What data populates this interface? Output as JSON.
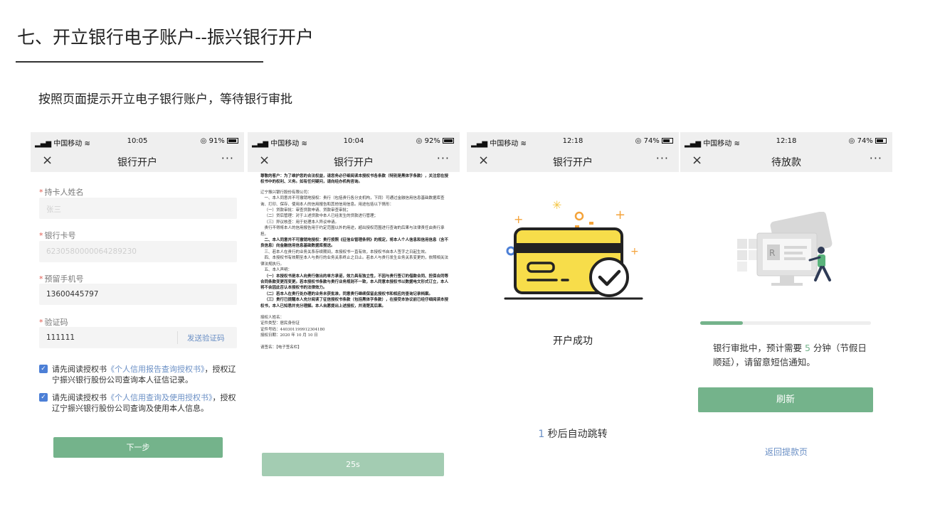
{
  "slide": {
    "title": "七、开立银行电子账户--振兴银行开户",
    "subtitle": "按照页面提示开立电子银行账户，等待银行审批"
  },
  "colors": {
    "accent_green": "#74b38b",
    "link_blue": "#6a8fc5",
    "required_red": "#e05a4f",
    "card_yellow": "#f7dd4a"
  },
  "phone1": {
    "status": {
      "carrier": "中国移动",
      "time": "10:05",
      "battery": "91%"
    },
    "nav": {
      "close": "×",
      "title": "银行开户",
      "more": "···"
    },
    "fields": [
      {
        "label": "持卡人姓名",
        "value": "张三",
        "placeholder": true
      },
      {
        "label": "银行卡号",
        "value": "6230580000064289230",
        "placeholder": true
      },
      {
        "label": "预留手机号",
        "value": "13600445797",
        "placeholder": false
      },
      {
        "label": "验证码",
        "value": "111111",
        "placeholder": false
      }
    ],
    "sms_button": "发送验证码",
    "agree1": {
      "pre": "请先阅读授权书",
      "link": "《个人信用报告查询授权书》",
      "post": "，授权辽宁振兴银行股份公司查询本人征信记录。"
    },
    "agree2": {
      "pre": "请先阅读授权书",
      "link": "《个人信用查询及使用授权书》",
      "post": "，授权辽宁振兴银行股份公司查询及使用本人信息。"
    },
    "next_button": "下一步"
  },
  "phone2": {
    "status": {
      "carrier": "中国移动",
      "time": "10:04",
      "battery": "92%"
    },
    "nav": {
      "close": "×",
      "title": "银行开户",
      "more": "···"
    },
    "doc": {
      "intro": "尊敬的客户：为了维护您的合法权益，请您务必仔细阅读本授权书各条款（特别是黑体字条款），关注您在授权书中的权利、义务。如有任何疑问，请向经办机构咨询。",
      "addressee": "辽宁振兴银行股份有限公司：",
      "p1": "一、本人同意并不可撤销地授权：贵行（包括贵行各分支机构，下同）可通过金融信用信息基础数据库查询、打印、保存、使用本人的信用报告和其他信用信息。用途包括以下情形：",
      "items": [
        "（一）贷款审批：审查贷款申请、贷款审查审批；",
        "（二）贷后管理：对于上述贷款中本人已经发生的贷款进行管理；",
        "（三）异议核查：用于处理本人异议申请。"
      ],
      "p2": "贵行不得将本人的信用报告用于约定范围以外的用途，超出授权范围进行查询的后果与法律责任由贵行承担。",
      "p3": "二、本人同意并不可撤销地授权：贵行按照《征信业管理条例》的规定，将本人个人信息和信用信息（含不良信息）向金融信用信息基础数据库报送。",
      "p4": "三、若本人在贵行的业务关系存续期间，本授权书一直有效，本授权书自本人签字之日起生效。",
      "p5": "四、本授权书有效期至本人与贵行的业务关系终止之日止。若本人与贵行发生业务关系变更的，依照相关法律法规执行。",
      "p6": "五、本人声明：",
      "d1": "（一）本授权书是本人向贵行做出的单方承诺，效力具有独立性，不因与贵行签订的借款合同、担保合同等合同条款变更而变更。若本授权书条款与贵行业务规则不一致，本人同意本授权书以数据电文形式订立，本人将不会因此否认本授权书的法律效力。",
      "d2": "（二）若本人在贵行处办理的业务未获批准，同意贵行继续保留此授权书和相应的查询记录档案。",
      "d3": "（三）贵行已提醒本人充分阅读了征信授权书条款（包括黑体字条款），在接受本协议前已经仔细阅读本授权书，本人已知悉并充分理解。本人自愿提出上述授权，并清楚其后果。",
      "sign1": "授权人姓名：",
      "sign2": "证件类型：居民身份证",
      "sign3": "证件号码：440301199912304180",
      "sign4": "授权日期：2020 年 10 月 10 日",
      "seal": "请签名：【电子签名栏】"
    },
    "countdown_button": "25s"
  },
  "phone3": {
    "status": {
      "carrier": "中国移动",
      "time": "12:18",
      "battery": "74%"
    },
    "nav": {
      "close": "×",
      "title": "银行开户",
      "more": "···"
    },
    "success": "开户成功",
    "redirect_num": "1",
    "redirect_text": " 秒后自动跳转"
  },
  "phone4": {
    "status": {
      "carrier": "中国移动",
      "time": "12:18",
      "battery": "74%"
    },
    "nav": {
      "close": "×",
      "title": "待放款",
      "more": "···"
    },
    "progress": 0.25,
    "status_pre": "银行审批中，预计需要 ",
    "status_num": "5",
    "status_post": " 分钟（节假日顺延），请留意短信通知。",
    "refresh_button": "刷新",
    "back_link": "返回提款页"
  }
}
